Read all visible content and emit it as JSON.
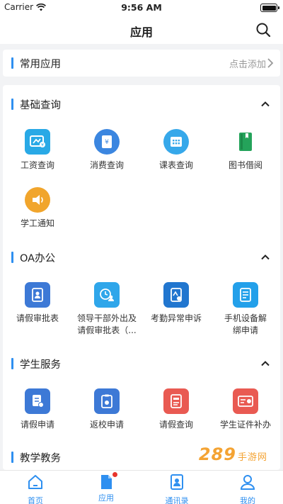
{
  "status_bar": {
    "carrier": "Carrier",
    "time": "9:56 AM"
  },
  "nav": {
    "title": "应用"
  },
  "favorites": {
    "title": "常用应用",
    "add_label": "点击添加"
  },
  "sections": [
    {
      "title": "基础查询",
      "items": [
        {
          "label": "工资查询",
          "icon": "salary-icon",
          "color": "#29a9e6"
        },
        {
          "label": "消费查询",
          "icon": "consume-icon",
          "color": "#3b86e0"
        },
        {
          "label": "课表查询",
          "icon": "timetable-icon",
          "color": "#36a8ea"
        },
        {
          "label": "图书借阅",
          "icon": "book-icon",
          "color": "#24a35a"
        },
        {
          "label": "学工通知",
          "icon": "notice-icon",
          "color": "#f1a52c"
        }
      ]
    },
    {
      "title": "OA办公",
      "items": [
        {
          "label": "请假审批表",
          "icon": "leave-approval-icon",
          "color": "#3d79d6"
        },
        {
          "label": "领导干部外出及\n请假审批表（...",
          "icon": "leader-out-icon",
          "color": "#2fa6ea"
        },
        {
          "label": "考勤异常申诉",
          "icon": "attendance-icon",
          "color": "#2176cf"
        },
        {
          "label": "手机设备解\n绑申请",
          "icon": "device-unbind-icon",
          "color": "#23a0ea"
        }
      ]
    },
    {
      "title": "学生服务",
      "items": [
        {
          "label": "请假申请",
          "icon": "leave-apply-icon",
          "color": "#3d79d6"
        },
        {
          "label": "返校申请",
          "icon": "return-school-icon",
          "color": "#3d79d6"
        },
        {
          "label": "请假查询",
          "icon": "leave-query-icon",
          "color": "#e95a52"
        },
        {
          "label": "学生证件补办",
          "icon": "id-reissue-icon",
          "color": "#e95a52"
        }
      ]
    },
    {
      "title": "教学教务",
      "items": []
    }
  ],
  "tabs": [
    {
      "label": "首页",
      "icon": "home-icon"
    },
    {
      "label": "应用",
      "icon": "apps-icon"
    },
    {
      "label": "通讯录",
      "icon": "contacts-icon"
    },
    {
      "label": "我的",
      "icon": "profile-icon"
    }
  ],
  "accent": "#2e8ff0",
  "watermark": {
    "text": "289",
    "sub": "手游网"
  }
}
